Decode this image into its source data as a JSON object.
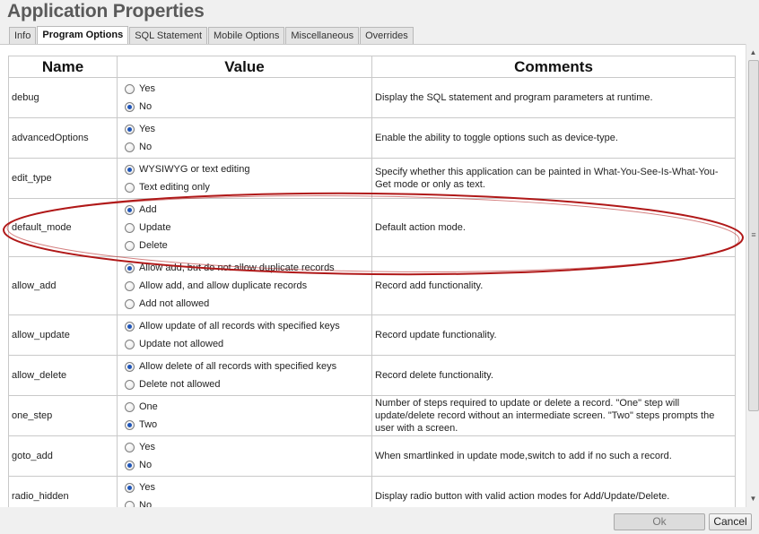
{
  "window": {
    "title": "Application Properties"
  },
  "tabs": [
    {
      "label": "Info",
      "active": false
    },
    {
      "label": "Program Options",
      "active": true
    },
    {
      "label": "SQL Statement",
      "active": false
    },
    {
      "label": "Mobile Options",
      "active": false
    },
    {
      "label": "Miscellaneous",
      "active": false
    },
    {
      "label": "Overrides",
      "active": false
    }
  ],
  "table": {
    "headers": {
      "name": "Name",
      "value": "Value",
      "comments": "Comments"
    },
    "rows": [
      {
        "name": "debug",
        "options": [
          {
            "label": "Yes",
            "checked": false
          },
          {
            "label": "No",
            "checked": true
          }
        ],
        "comment": "Display the SQL statement and program parameters at runtime."
      },
      {
        "name": "advancedOptions",
        "options": [
          {
            "label": "Yes",
            "checked": true
          },
          {
            "label": "No",
            "checked": false
          }
        ],
        "comment": "Enable the ability to toggle options such as device-type."
      },
      {
        "name": "edit_type",
        "options": [
          {
            "label": "WYSIWYG or text editing",
            "checked": true
          },
          {
            "label": "Text editing only",
            "checked": false
          }
        ],
        "comment": "Specify whether this application can be painted in What-You-See-Is-What-You-Get mode or only as text."
      },
      {
        "name": "default_mode",
        "options": [
          {
            "label": "Add",
            "checked": true
          },
          {
            "label": "Update",
            "checked": false
          },
          {
            "label": "Delete",
            "checked": false
          }
        ],
        "comment": "Default action mode."
      },
      {
        "name": "allow_add",
        "options": [
          {
            "label": "Allow add, but do not allow duplicate records",
            "checked": true
          },
          {
            "label": "Allow add, and allow duplicate records",
            "checked": false
          },
          {
            "label": "Add not allowed",
            "checked": false
          }
        ],
        "comment": "Record add functionality."
      },
      {
        "name": "allow_update",
        "options": [
          {
            "label": "Allow update of all records with specified keys",
            "checked": true
          },
          {
            "label": "Update not allowed",
            "checked": false
          }
        ],
        "comment": "Record update functionality."
      },
      {
        "name": "allow_delete",
        "options": [
          {
            "label": "Allow delete of all records with specified keys",
            "checked": true
          },
          {
            "label": "Delete not allowed",
            "checked": false
          }
        ],
        "comment": "Record delete functionality."
      },
      {
        "name": "one_step",
        "options": [
          {
            "label": "One",
            "checked": false
          },
          {
            "label": "Two",
            "checked": true
          }
        ],
        "comment": "Number of steps required to update or delete a record. \"One\" step will update/delete record without an intermediate screen. \"Two\" steps prompts the user with a screen."
      },
      {
        "name": "goto_add",
        "options": [
          {
            "label": "Yes",
            "checked": false
          },
          {
            "label": "No",
            "checked": true
          }
        ],
        "comment": "When smartlinked in update mode,switch to add if no such a record."
      },
      {
        "name": "radio_hidden",
        "options": [
          {
            "label": "Yes",
            "checked": true
          },
          {
            "label": "No",
            "checked": false
          }
        ],
        "comment": "Display radio button with valid action modes for Add/Update/Delete."
      }
    ]
  },
  "annotation": {
    "color": "#b01818"
  },
  "footer": {
    "ok_label": "Ok",
    "cancel_label": "Cancel"
  },
  "icons": {
    "scroll_up": "triangle-up-icon",
    "scroll_down": "triangle-down-icon",
    "grip": "grip-lines-icon"
  }
}
